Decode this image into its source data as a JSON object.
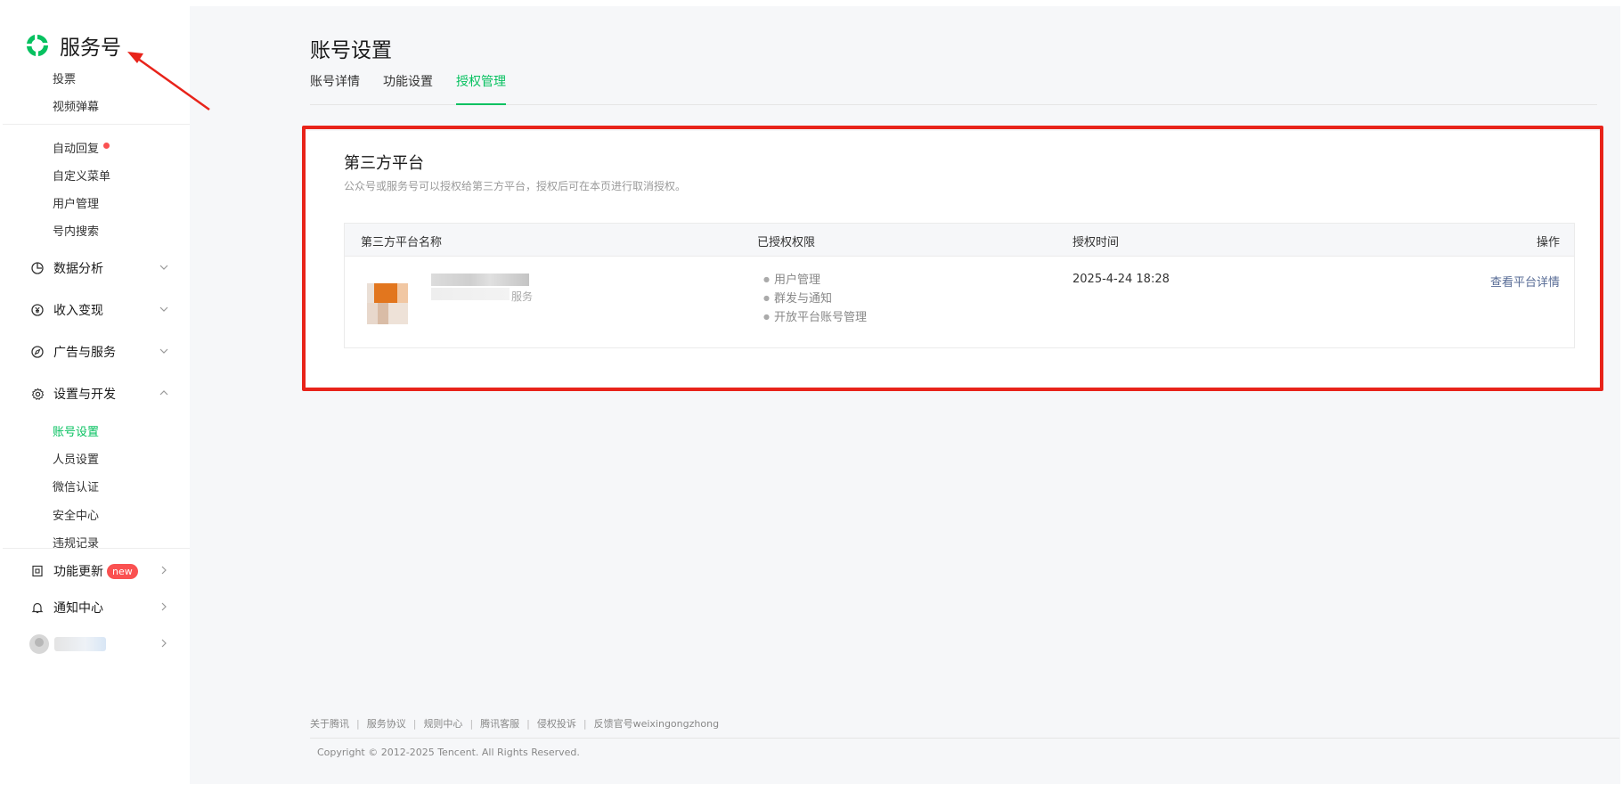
{
  "brand": {
    "name": "服务号"
  },
  "sidebar": {
    "top_items": [
      {
        "label": "投票"
      },
      {
        "label": "视频弹幕"
      }
    ],
    "interact_items": [
      {
        "label": "自动回复"
      },
      {
        "label": "自定义菜单"
      },
      {
        "label": "用户管理"
      },
      {
        "label": "号内搜索"
      }
    ],
    "groups": {
      "data_analysis": "数据分析",
      "monetization": "收入变现",
      "ads": "广告与服务",
      "settings_dev": "设置与开发"
    },
    "settings_items": [
      {
        "label": "账号设置",
        "active": true
      },
      {
        "label": "人员设置"
      },
      {
        "label": "微信认证"
      },
      {
        "label": "安全中心"
      },
      {
        "label": "违规记录"
      }
    ],
    "bottom": {
      "updates": "功能更新",
      "new_badge": "new",
      "notifications": "通知中心"
    }
  },
  "page": {
    "title": "账号设置",
    "tabs": [
      {
        "label": "账号详情"
      },
      {
        "label": "功能设置"
      },
      {
        "label": "授权管理",
        "active": true
      }
    ]
  },
  "third_party": {
    "title": "第三方平台",
    "description": "公众号或服务号可以授权给第三方平台，授权后可在本页进行取消授权。",
    "columns": {
      "name": "第三方平台名称",
      "permissions": "已授权权限",
      "time": "授权时间",
      "action": "操作"
    },
    "rows": [
      {
        "name_suffix": "服务",
        "permissions": [
          "用户管理",
          "群发与通知",
          "开放平台账号管理"
        ],
        "time": "2025-4-24 18:28",
        "action": "查看平台详情"
      }
    ]
  },
  "footer": {
    "links": [
      "关于腾讯",
      "服务协议",
      "规则中心",
      "腾讯客服",
      "侵权投诉",
      "反馈官号weixingongzhong"
    ],
    "copyright": "Copyright © 2012-2025 Tencent. All Rights Reserved."
  },
  "colors": {
    "accent": "#07c160",
    "annotation": "#e8231a",
    "link": "#576b95",
    "badge": "#fa5151"
  }
}
